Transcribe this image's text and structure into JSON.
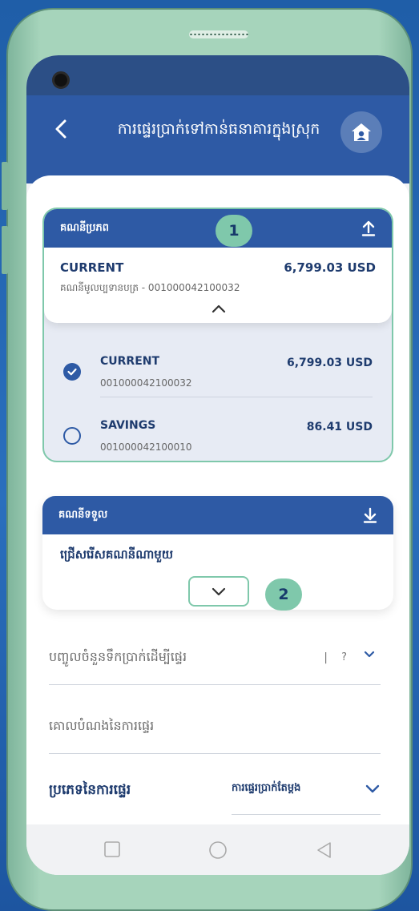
{
  "header": {
    "title": "ការផ្ទេរប្រាក់ទៅកាន់ធនាគារក្នុងស្រុក"
  },
  "source_account": {
    "header_label": "គណនីប្រភព",
    "badge": "1",
    "selected": {
      "type": "CURRENT",
      "balance": "6,799.03 USD",
      "description": "គណនីមូលប្បទានបត្រ - 001000042100032"
    },
    "accounts": [
      {
        "type": "CURRENT",
        "number": "001000042100032",
        "balance": "6,799.03 USD",
        "selected": true
      },
      {
        "type": "SAVINGS",
        "number": "001000042100010",
        "balance": "86.41 USD",
        "selected": false
      }
    ]
  },
  "destination_account": {
    "header_label": "គណនីទទួល",
    "placeholder": "ជ្រើសរើសគណនីណាមួយ",
    "badge": "2"
  },
  "amount": {
    "placeholder": "បញ្ចូលចំនួនទឹកប្រាក់ដើម្បីផ្ទេរ",
    "separator": "|",
    "currency": "?"
  },
  "purpose": {
    "placeholder": "គោលបំណងនៃការផ្ទេរ"
  },
  "transfer_type": {
    "label": "ប្រភេទនៃការផ្ទេរ",
    "value": "ការផ្ទេរប្រាក់តែម្តង"
  },
  "colors": {
    "primary": "#2e5aa5",
    "accent": "#7fc8ab",
    "text_dark": "#1e3b6e"
  }
}
